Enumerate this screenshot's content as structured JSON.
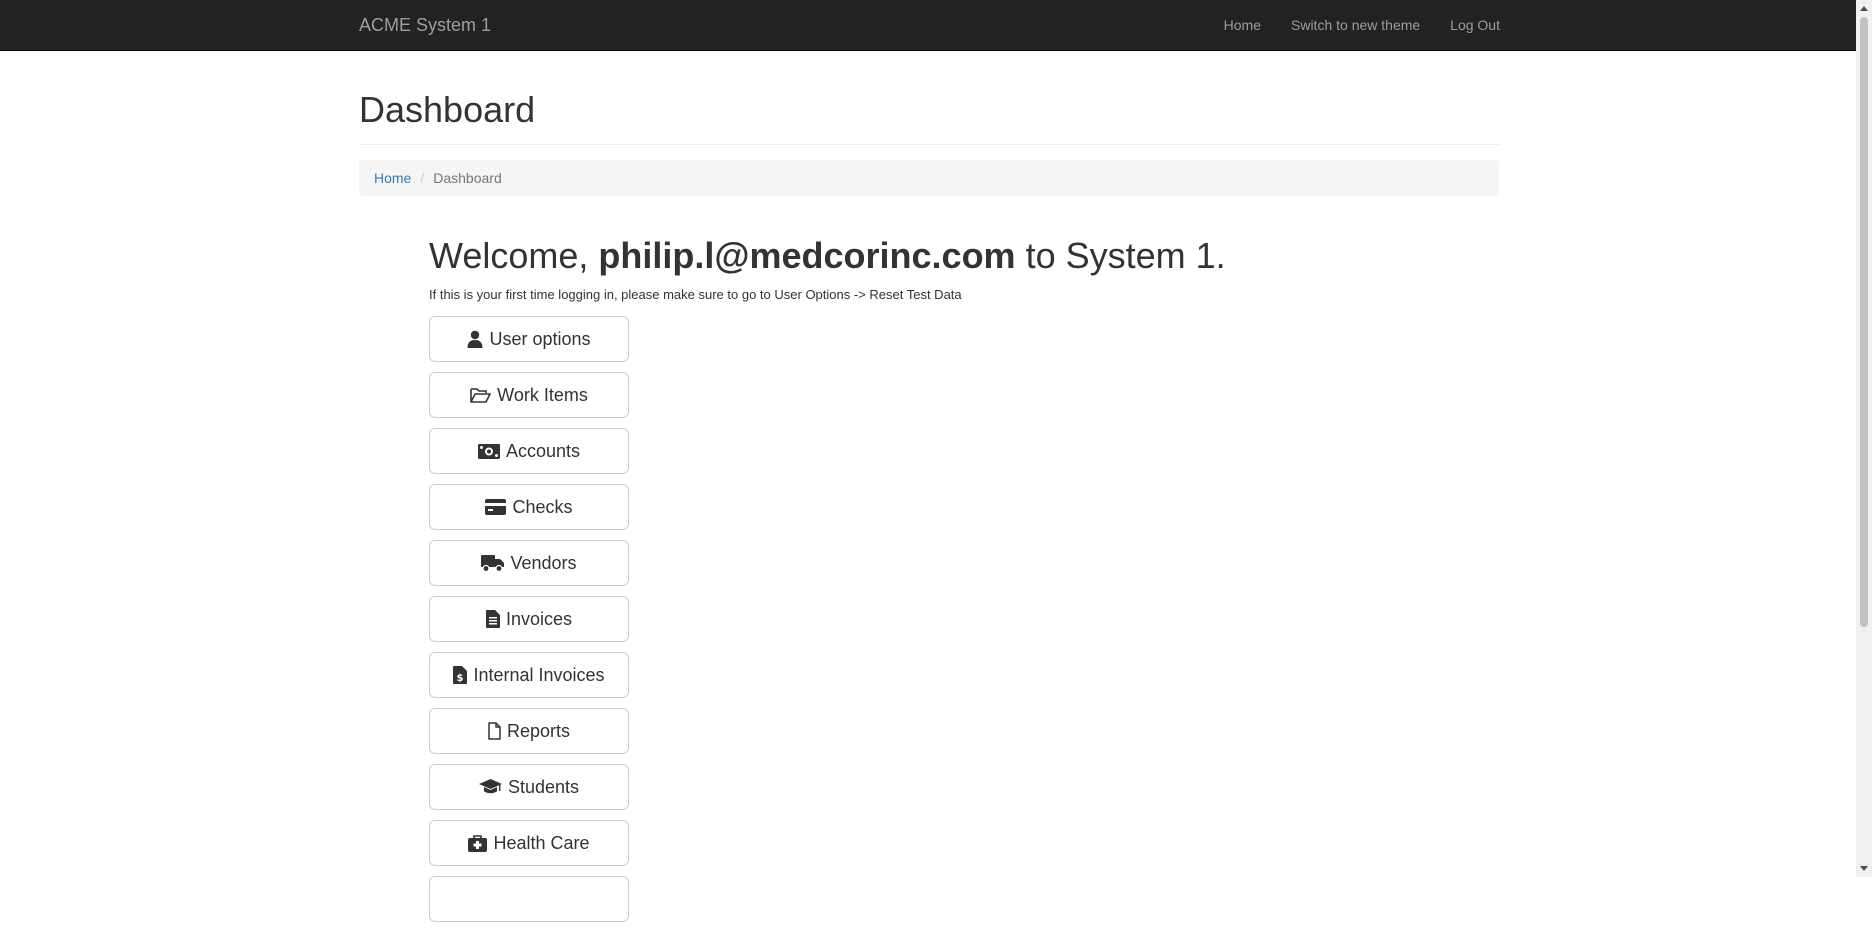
{
  "navbar": {
    "brand": "ACME System 1",
    "links": [
      "Home",
      "Switch to new theme",
      "Log Out"
    ]
  },
  "page": {
    "title": "Dashboard"
  },
  "breadcrumb": {
    "home": "Home",
    "separator": "/",
    "current": "Dashboard"
  },
  "welcome": {
    "prefix": "Welcome,",
    "user": "philip.l@medcorinc.com",
    "suffix": "to System 1.",
    "hint": "If this is your first time logging in, please make sure to go to User Options -> Reset Test Data"
  },
  "buttons": [
    {
      "label": "User options",
      "icon": "user-icon"
    },
    {
      "label": "Work Items",
      "icon": "folder-open-icon"
    },
    {
      "label": "Accounts",
      "icon": "money-icon"
    },
    {
      "label": "Checks",
      "icon": "credit-card-icon"
    },
    {
      "label": "Vendors",
      "icon": "truck-icon"
    },
    {
      "label": "Invoices",
      "icon": "file-text-icon"
    },
    {
      "label": "Internal Invoices",
      "icon": "file-invoice-dollar-icon"
    },
    {
      "label": "Reports",
      "icon": "file-icon"
    },
    {
      "label": "Students",
      "icon": "graduation-cap-icon"
    },
    {
      "label": "Health Care",
      "icon": "medkit-icon"
    }
  ],
  "colors": {
    "navbar_bg": "#222222",
    "navbar_text": "#9d9d9d",
    "link": "#337ab7",
    "breadcrumb_bg": "#f5f5f5"
  }
}
